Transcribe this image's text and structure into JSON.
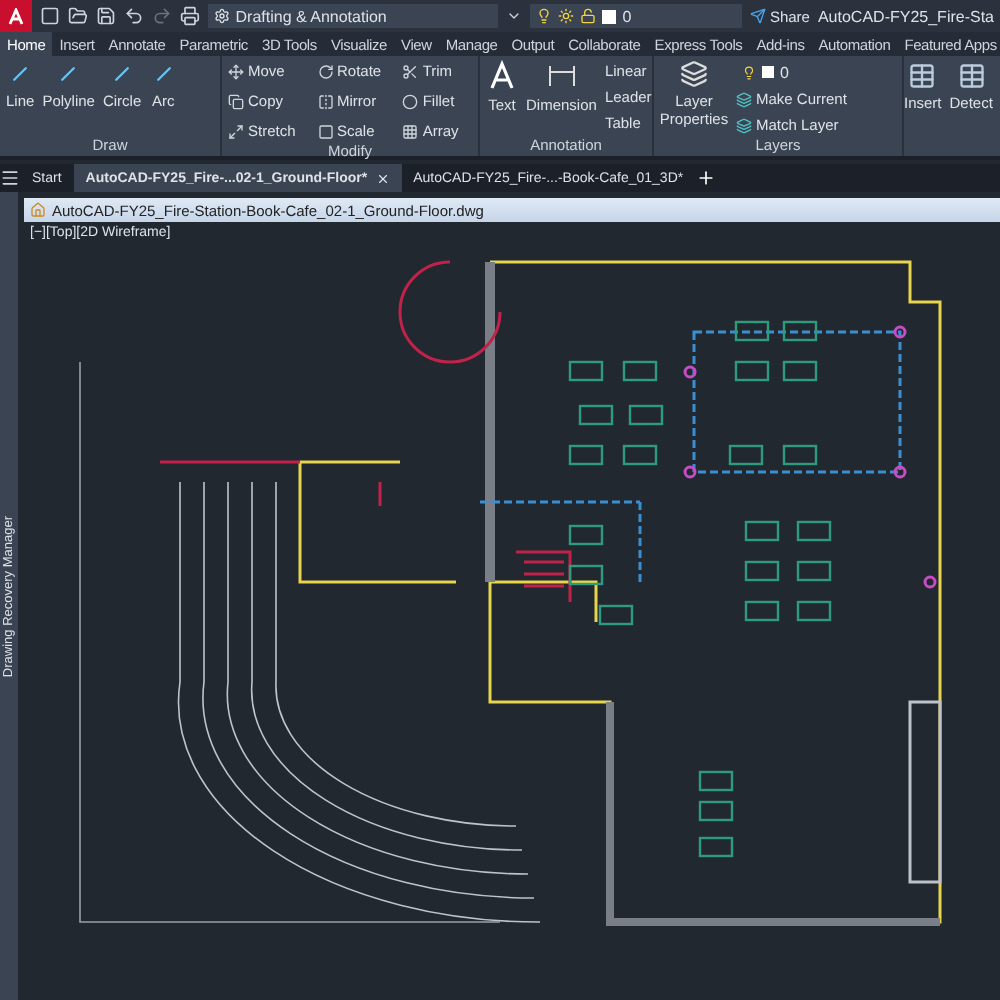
{
  "title_bar": {
    "workspace": "Drafting & Annotation",
    "layer": "0",
    "share": "Share",
    "title": "AutoCAD-FY25_Fire-Sta"
  },
  "ribbon_tabs": [
    {
      "label": "Home",
      "selected": true
    },
    {
      "label": "Insert",
      "selected": false
    },
    {
      "label": "Annotate",
      "selected": false
    },
    {
      "label": "Parametric",
      "selected": false
    },
    {
      "label": "3D Tools",
      "selected": false
    },
    {
      "label": "Visualize",
      "selected": false
    },
    {
      "label": "View",
      "selected": false
    },
    {
      "label": "Manage",
      "selected": false
    },
    {
      "label": "Output",
      "selected": false
    },
    {
      "label": "Collaborate",
      "selected": false
    },
    {
      "label": "Express Tools",
      "selected": false
    },
    {
      "label": "Add-ins",
      "selected": false
    },
    {
      "label": "Automation",
      "selected": false
    },
    {
      "label": "Featured Apps",
      "selected": false
    }
  ],
  "panels": {
    "draw": {
      "title": "Draw",
      "tools": [
        "Line",
        "Polyline",
        "Circle",
        "Arc"
      ]
    },
    "modify": {
      "title": "Modify",
      "tools": [
        "Move",
        "Rotate",
        "Trim",
        "Copy",
        "Mirror",
        "Fillet",
        "Stretch",
        "Scale",
        "Array"
      ]
    },
    "annotation": {
      "title": "Annotation",
      "big": [
        "Text",
        "Dimension"
      ],
      "small": [
        "Linear",
        "Leader",
        "Table"
      ]
    },
    "layers": {
      "title": "Layers",
      "big": "Layer Properties",
      "layer": "0",
      "small": [
        "Make Current",
        "Match Layer"
      ]
    },
    "extra": [
      "Insert",
      "Detect"
    ]
  },
  "file_tabs": [
    {
      "label": "Start",
      "selected": false
    },
    {
      "label": "AutoCAD-FY25_Fire-...02-1_Ground-Floor*",
      "selected": true
    },
    {
      "label": "AutoCAD-FY25_Fire-...-Book-Cafe_01_3D*",
      "selected": false
    }
  ],
  "drawing": {
    "title": "AutoCAD-FY25_Fire-Station-Book-Cafe_02-1_Ground-Floor.dwg",
    "viewport": "[−][Top][2D Wireframe]",
    "side_panel": "Drawing Recovery Manager"
  }
}
